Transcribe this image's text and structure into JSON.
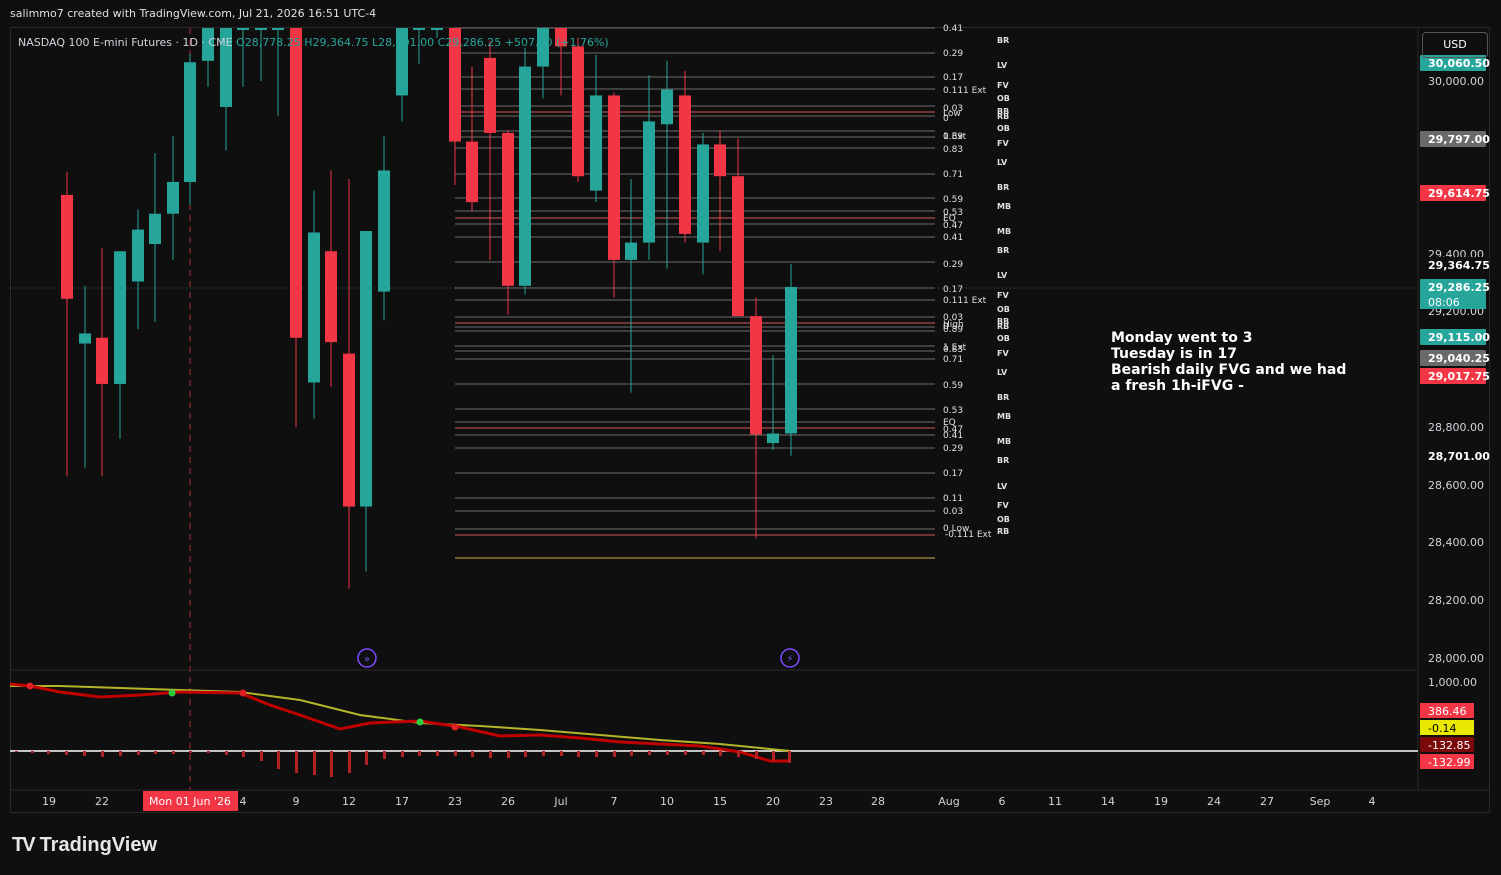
{
  "header": {
    "attribution": "salimmo7 created with TradingView.com, Jul 21, 2026 16:51 UTC-4"
  },
  "legend": {
    "symbol": "NASDAQ 100 E-mini Futures · 1D · CME",
    "open": "O28,778.25",
    "high": "H29,364.75",
    "low": "L28,701.00",
    "close": "C29,286.25",
    "change": "+507.50 (+1.76%)"
  },
  "currency": "USD",
  "note": {
    "lines": [
      "Monday went to 3",
      "Tuesday is in 17",
      "Bearish daily FVG and we had",
      "a fresh 1h-iFVG -"
    ]
  },
  "brand": {
    "logo_text": "TradingView"
  },
  "colors": {
    "up": "#26a69a",
    "down": "#f23645",
    "background": "#0f0f0f",
    "highlight_red": "#f23645",
    "level_gray": "#8a8a8a",
    "ma_fast": "#c00000",
    "ma_slow": "#b5b52a"
  },
  "chart_data": {
    "type": "candlestick",
    "symbol": "NASDAQ 100 E-mini Futures",
    "timeframe": "1D",
    "exchange": "CME",
    "ylim": [
      27900,
      30200
    ],
    "y_ticks": [
      "28,000.00",
      "28,200.00",
      "28,400.00",
      "28,600.00",
      "28,800.00",
      "29,200.00",
      "29,400.00",
      "30,000.00"
    ],
    "x_ticks": [
      "19",
      "22",
      "Mon 01 Jun '26",
      "4",
      "9",
      "12",
      "17",
      "23",
      "26",
      "Jul",
      "7",
      "10",
      "15",
      "20",
      "23",
      "28",
      "Aug",
      "6",
      "11",
      "14",
      "19",
      "24",
      "27",
      "Sep",
      "4"
    ],
    "cursor_date_label": "Mon 01 Jun '26",
    "candles": [
      {
        "o": 29605,
        "h": 29685,
        "l": 28630,
        "c": 29245
      },
      {
        "o": 29090,
        "h": 29290,
        "l": 28660,
        "c": 29125
      },
      {
        "o": 29110,
        "h": 29420,
        "l": 28630,
        "c": 28950
      },
      {
        "o": 28950,
        "h": 29390,
        "l": 28760,
        "c": 29410
      },
      {
        "o": 29305,
        "h": 29555,
        "l": 29140,
        "c": 29485
      },
      {
        "o": 29435,
        "h": 29750,
        "l": 29165,
        "c": 29540
      },
      {
        "o": 29540,
        "h": 29810,
        "l": 29380,
        "c": 29650
      },
      {
        "o": 29650,
        "h": 30095,
        "l": 29570,
        "c": 30065
      },
      {
        "o": 30070,
        "h": 30120,
        "l": 29980,
        "c": 30200
      },
      {
        "o": 29910,
        "h": 30160,
        "l": 29760,
        "c": 30200
      },
      {
        "o": 30200,
        "h": 30220,
        "l": 29980,
        "c": 30200
      },
      {
        "o": 30200,
        "h": 30220,
        "l": 30000,
        "c": 30200
      },
      {
        "o": 30200,
        "h": 30240,
        "l": 29880,
        "c": 30200
      },
      {
        "o": 30200,
        "h": 30220,
        "l": 28800,
        "c": 29110
      },
      {
        "o": 28955,
        "h": 29620,
        "l": 28830,
        "c": 29475
      },
      {
        "o": 29410,
        "h": 29690,
        "l": 28940,
        "c": 29095
      },
      {
        "o": 29055,
        "h": 29660,
        "l": 28240,
        "c": 28525
      },
      {
        "o": 28525,
        "h": 28575,
        "l": 28300,
        "c": 29480
      },
      {
        "o": 29270,
        "h": 29810,
        "l": 29170,
        "c": 29690
      },
      {
        "o": 29950,
        "h": 30220,
        "l": 29860,
        "c": 30200
      },
      {
        "o": 30200,
        "h": 30200,
        "l": 30060,
        "c": 30200
      },
      {
        "o": 30200,
        "h": 30200,
        "l": 30150,
        "c": 30200
      },
      {
        "o": 30200,
        "h": 30220,
        "l": 29640,
        "c": 29790
      },
      {
        "o": 29790,
        "h": 30050,
        "l": 29550,
        "c": 29580
      },
      {
        "o": 30080,
        "h": 30140,
        "l": 29380,
        "c": 29820
      },
      {
        "o": 29820,
        "h": 29830,
        "l": 29190,
        "c": 29290
      },
      {
        "o": 29290,
        "h": 30115,
        "l": 29260,
        "c": 30050
      },
      {
        "o": 30050,
        "h": 30180,
        "l": 29940,
        "c": 30200
      },
      {
        "o": 30200,
        "h": 30200,
        "l": 29950,
        "c": 30120
      },
      {
        "o": 30120,
        "h": 30150,
        "l": 29650,
        "c": 29670
      },
      {
        "o": 29620,
        "h": 30090,
        "l": 29580,
        "c": 29950
      },
      {
        "o": 29950,
        "h": 29960,
        "l": 29250,
        "c": 29380
      },
      {
        "o": 29380,
        "h": 29660,
        "l": 28920,
        "c": 29440
      },
      {
        "o": 29440,
        "h": 30020,
        "l": 29380,
        "c": 29860
      },
      {
        "o": 29850,
        "h": 30070,
        "l": 29350,
        "c": 29970
      },
      {
        "o": 29950,
        "h": 30035,
        "l": 29440,
        "c": 29470
      },
      {
        "o": 29440,
        "h": 29820,
        "l": 29330,
        "c": 29780
      },
      {
        "o": 29780,
        "h": 29830,
        "l": 29410,
        "c": 29670
      },
      {
        "o": 29670,
        "h": 29800,
        "l": 29270,
        "c": 29185
      },
      {
        "o": 29185,
        "h": 29250,
        "l": 28415,
        "c": 28775
      },
      {
        "o": 28745,
        "h": 29050,
        "l": 28720,
        "c": 28778
      },
      {
        "o": 28778.25,
        "h": 29364.75,
        "l": 28701.0,
        "c": 29286.25
      }
    ],
    "fib_levels_upper": [
      "0.41",
      "0.29",
      "0.17",
      "0.111 Ext",
      "0.03",
      "Low",
      "0",
      "0.89",
      "1 Ext",
      "0.83",
      "0.71",
      "0.59",
      "0.53",
      "EQ",
      "0.47",
      "0.41"
    ],
    "fib_levels_lower": [
      "0.29",
      "0.17",
      "0.111 Ext",
      "0.03",
      "High",
      "0",
      "0.89",
      "1 Ext",
      "0.83",
      "0.71",
      "0.59",
      "0.53",
      "EQ",
      "0.47",
      "0.41",
      "0.29",
      "0.17",
      "0.11",
      "0.03",
      "0 Low",
      "-0.111 Ext"
    ],
    "zone_labels_upper": [
      "BR",
      "LV",
      "FV",
      "OB",
      "BB",
      "RB",
      "OB",
      "FV",
      "LV",
      "BR",
      "MB",
      "MB",
      "BR"
    ],
    "zone_labels_lower": [
      "LV",
      "FV",
      "OB",
      "BB",
      "RB",
      "OB",
      "FV",
      "LV",
      "BR",
      "MB",
      "MB",
      "BR",
      "LV",
      "FV",
      "OB",
      "RB"
    ],
    "price_labels": [
      {
        "text": "30,060.50",
        "kind": "green"
      },
      {
        "text": "30,000.00",
        "kind": "axis"
      },
      {
        "text": "29,797.00",
        "kind": "gray"
      },
      {
        "text": "29,614.75",
        "kind": "red"
      },
      {
        "text": "29,364.75",
        "kind": "black"
      },
      {
        "text": "29,286.25",
        "kind": "green"
      },
      {
        "text": "08:06",
        "kind": "green"
      },
      {
        "text": "29,115.00",
        "kind": "green"
      },
      {
        "text": "29,040.25",
        "kind": "gray"
      },
      {
        "text": "29,017.75",
        "kind": "red"
      },
      {
        "text": "28,701.00",
        "kind": "black"
      }
    ],
    "indicator": {
      "axis_label": "1,000.00",
      "values": [
        "386.46",
        "-0.14",
        "-132.85",
        "-132.99"
      ],
      "value_kinds": [
        "red",
        "yellow",
        "darkred",
        "red"
      ]
    }
  }
}
